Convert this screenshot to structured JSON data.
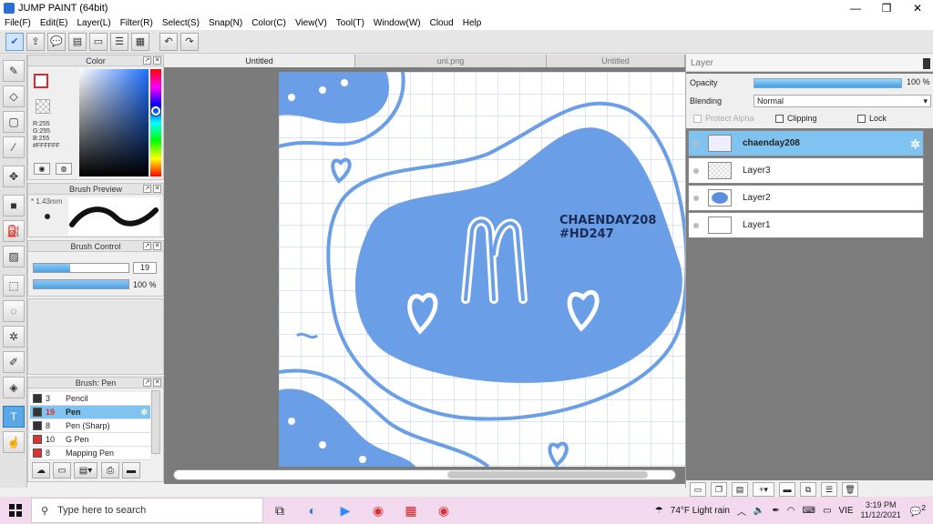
{
  "window": {
    "title": "JUMP PAINT (64bit)",
    "min": "—",
    "max": "❐",
    "close": "✕"
  },
  "menu": [
    "File(F)",
    "Edit(E)",
    "Layer(L)",
    "Filter(R)",
    "Select(S)",
    "Snap(N)",
    "Color(C)",
    "View(V)",
    "Tool(T)",
    "Window(W)",
    "Cloud",
    "Help"
  ],
  "color_panel": {
    "title": "Color",
    "r": "R:255",
    "g": "G:255",
    "b": "B:255",
    "hex": "#FFFFFF"
  },
  "brush_preview": {
    "title": "Brush Preview",
    "size": "1.43mm"
  },
  "brush_control": {
    "title": "Brush Control",
    "size_value": "19",
    "size_fill": 0.38,
    "opacity_value": "100 %",
    "opacity_fill": 1.0
  },
  "brush_list": {
    "title": "Brush: Pen",
    "items": [
      {
        "num": "3",
        "name": "Pencil",
        "color": "#333333"
      },
      {
        "num": "19",
        "name": "Pen",
        "color": "#333333",
        "selected": true
      },
      {
        "num": "8",
        "name": "Pen (Sharp)",
        "color": "#333333"
      },
      {
        "num": "10",
        "name": "G Pen",
        "color": "#e03030"
      },
      {
        "num": "8",
        "name": "Mapping Pen",
        "color": "#e03030"
      }
    ]
  },
  "doc_tabs": [
    "Untitled",
    "uni.png",
    "Untitled"
  ],
  "canvas": {
    "text_line1": "CHAENDAY208",
    "text_line2": "#HD247",
    "letter": "m",
    "bg": "#ffffff",
    "blob": "#6a9ee6"
  },
  "layer_panel": {
    "title": "Layer",
    "opacity_label": "Opacity",
    "opacity_value": "100 %",
    "blending_label": "Blending",
    "blending_value": "Normal",
    "protect_alpha": "Protect Alpha",
    "clipping": "Clipping",
    "lock": "Lock",
    "layers": [
      {
        "name": "chaenday208",
        "selected": true
      },
      {
        "name": "Layer3"
      },
      {
        "name": "Layer2"
      },
      {
        "name": "Layer1"
      }
    ]
  },
  "taskbar": {
    "search_placeholder": "Type here to search",
    "weather": "74°F  Light rain",
    "lang": "VIE",
    "time": "3:19 PM",
    "date": "11/12/2021",
    "notif": "2"
  }
}
